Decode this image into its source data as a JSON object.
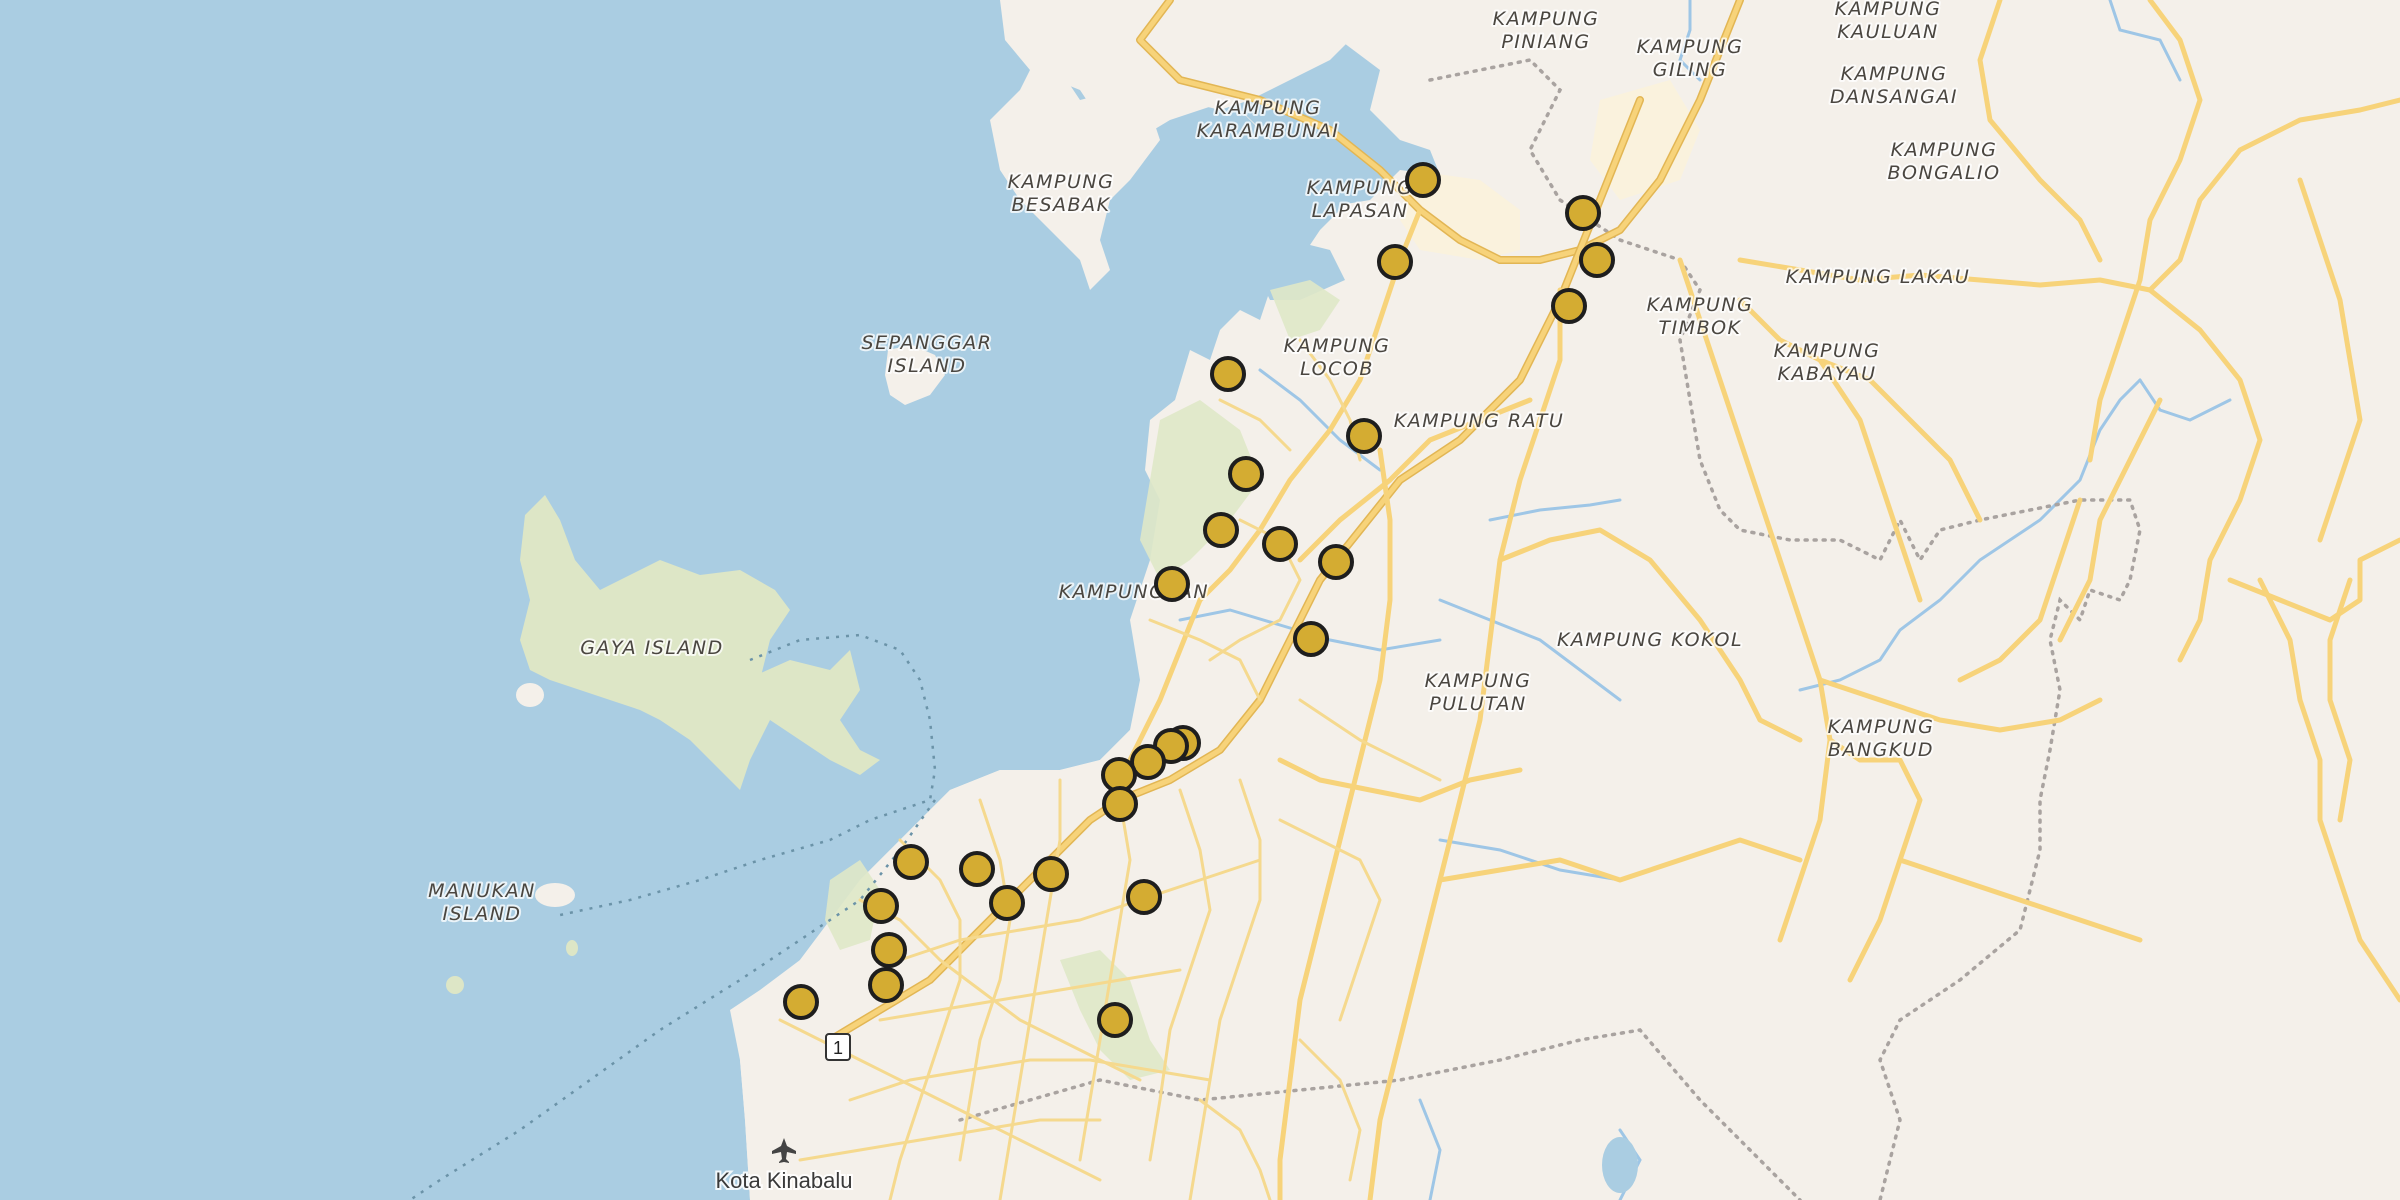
{
  "map": {
    "colors": {
      "water": "#aacde2",
      "land": "#f4f0ea",
      "park": "#dfe8c8",
      "urban": "#f8f2ec",
      "road_major": "#f7d37a",
      "marker_fill": "#d4ac32",
      "marker_stroke": "#1e1e1e"
    },
    "place_labels": [
      {
        "id": "kampung-piniang",
        "lines": [
          "KAMPUNG",
          "PINIANG"
        ]
      },
      {
        "id": "kampung-giling",
        "lines": [
          "KAMPUNG",
          "GILING"
        ]
      },
      {
        "id": "kampung-kauluan",
        "lines": [
          "KAMPUNG",
          "KAULUAN"
        ]
      },
      {
        "id": "kampung-dansangai",
        "lines": [
          "KAMPUNG",
          "DANSANGAI"
        ]
      },
      {
        "id": "kampung-karambunai",
        "lines": [
          "KAMPUNG",
          "KARAMBUNAI"
        ]
      },
      {
        "id": "kampung-bongalio",
        "lines": [
          "KAMPUNG",
          "BONGALIO"
        ]
      },
      {
        "id": "kampung-besabak",
        "lines": [
          "KAMPUNG",
          "BESABAK"
        ]
      },
      {
        "id": "kampung-lapasan",
        "lines": [
          "KAMPUNG",
          "LAPASAN"
        ]
      },
      {
        "id": "kampung-lakau",
        "lines": [
          "KAMPUNG LAKAU"
        ]
      },
      {
        "id": "kampung-timbok",
        "lines": [
          "KAMPUNG",
          "TIMBOK"
        ]
      },
      {
        "id": "kampung-kabayau",
        "lines": [
          "KAMPUNG",
          "KABAYAU"
        ]
      },
      {
        "id": "sepanggar-island",
        "lines": [
          "SEPANGGAR",
          "ISLAND"
        ]
      },
      {
        "id": "kampung-locob",
        "lines": [
          "KAMPUNG",
          "LOCOB"
        ]
      },
      {
        "id": "kampung-ratu",
        "lines": [
          "KAMPUNG RATU"
        ]
      },
      {
        "id": "kampung-ban",
        "lines": [
          "KAMPUNG",
          "AN"
        ]
      },
      {
        "id": "gaya-island",
        "lines": [
          "GAYA ISLAND"
        ]
      },
      {
        "id": "kampung-kokol",
        "lines": [
          "KAMPUNG KOKOL"
        ]
      },
      {
        "id": "kampung-pulutan",
        "lines": [
          "KAMPUNG",
          "PULUTAN"
        ]
      },
      {
        "id": "kampung-bangkud",
        "lines": [
          "KAMPUNG",
          "BANGKUD"
        ]
      },
      {
        "id": "manukan-island",
        "lines": [
          "MANUKAN",
          "ISLAND"
        ]
      }
    ],
    "city_label": "Kota Kinabalu",
    "airport_icon": "airplane-icon",
    "route_shield": "1",
    "marker_count": 27
  }
}
